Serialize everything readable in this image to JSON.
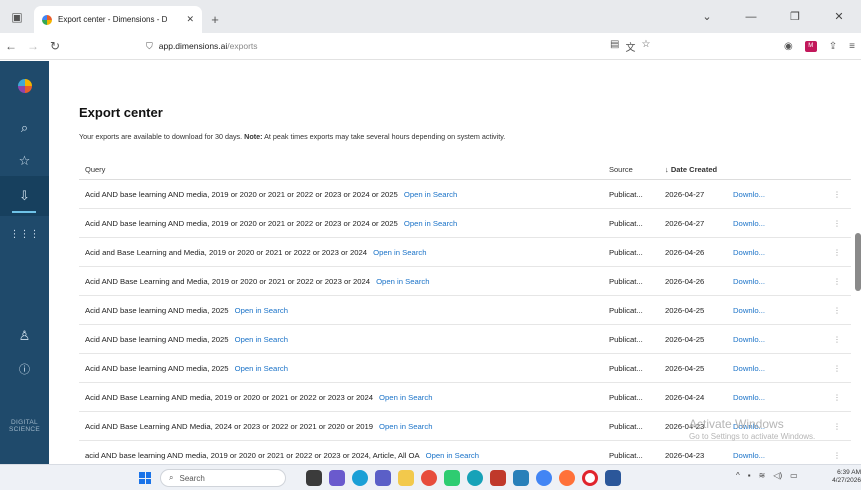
{
  "browser": {
    "tab_title": "Export center - Dimensions - D",
    "url_host": "app.dimensions.ai",
    "url_path": "/exports"
  },
  "sidebar": {
    "brand": "DIGITAL SCIENCE"
  },
  "page": {
    "title": "Export center",
    "info_prefix": "Your exports are available to download for 30 days.",
    "info_note_label": "Note:",
    "info_note": "At peak times exports may take several hours depending on system activity."
  },
  "table": {
    "headers": {
      "query": "Query",
      "source": "Source",
      "date": "↓ Date Created"
    },
    "open_label": "Open in Search",
    "rows": [
      {
        "query": "Acid AND base learning AND media, 2019 or 2020 or 2021 or 2022 or 2023 or 2024 or 2025",
        "source": "Publicat...",
        "date": "2026-04-27",
        "action": "Downlo..."
      },
      {
        "query": "Acid AND base learning AND media, 2019 or 2020 or 2021 or 2022 or 2023 or 2024 or 2025",
        "source": "Publicat...",
        "date": "2026-04-27",
        "action": "Downlo..."
      },
      {
        "query": "Acid and Base Learning and Media, 2019 or 2020 or 2021 or 2022 or 2023 or 2024",
        "source": "Publicat...",
        "date": "2026-04-26",
        "action": "Downlo..."
      },
      {
        "query": "Acid AND Base Learning and Media, 2019 or 2020 or 2021 or 2022 or 2023 or 2024",
        "source": "Publicat...",
        "date": "2026-04-26",
        "action": "Downlo..."
      },
      {
        "query": "Acid AND base learning AND media, 2025",
        "source": "Publicat...",
        "date": "2026-04-25",
        "action": "Downlo..."
      },
      {
        "query": "Acid AND base learning AND media, 2025",
        "source": "Publicat...",
        "date": "2026-04-25",
        "action": "Downlo..."
      },
      {
        "query": "Acid AND base learning AND media, 2025",
        "source": "Publicat...",
        "date": "2026-04-25",
        "action": "Downlo..."
      },
      {
        "query": "Acid AND Base Learning AND media, 2019 or 2020 or 2021 or 2022 or 2023 or 2024",
        "source": "Publicat...",
        "date": "2026-04-24",
        "action": "Downlo..."
      },
      {
        "query": "Acid AND Base Learning AND Media, 2024 or 2023 or 2022 or 2021 or 2020 or 2019",
        "source": "Publicat...",
        "date": "2026-04-23",
        "action": "Downlo..."
      },
      {
        "query": "acid AND base learning AND media, 2019 or 2020 or 2021 or 2022 or 2023 or 2024, Article, All OA",
        "source": "Publicat...",
        "date": "2026-04-23",
        "action": "Downlo..."
      }
    ]
  },
  "watermark": {
    "line1": "Activate Windows",
    "line2": "Go to Settings to activate Windows."
  },
  "taskbar": {
    "search_placeholder": "Search",
    "time": "6:39 AM",
    "date": "4/27/2026"
  }
}
